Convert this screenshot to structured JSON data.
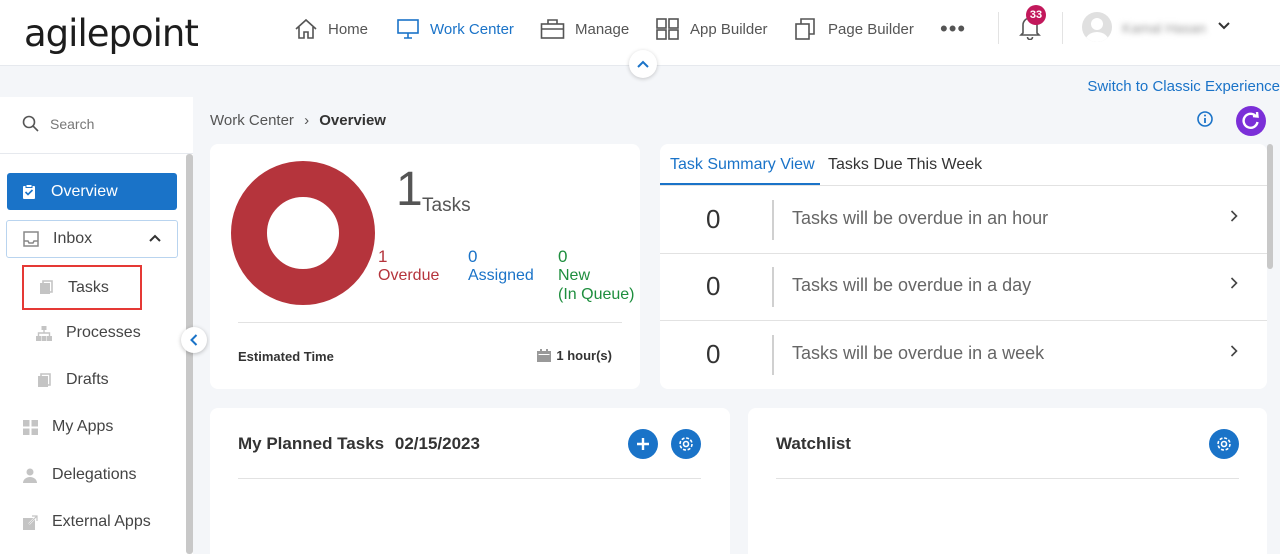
{
  "header": {
    "logo": "agilepoint",
    "nav": [
      {
        "label": "Home",
        "icon": "home-icon"
      },
      {
        "label": "Work Center",
        "icon": "monitor-icon",
        "active": true
      },
      {
        "label": "Manage",
        "icon": "briefcase-icon"
      },
      {
        "label": "App Builder",
        "icon": "grid-icon"
      },
      {
        "label": "Page Builder",
        "icon": "pages-icon"
      }
    ],
    "more": "•••",
    "notification_count": "33",
    "user_name": "Kamal Hasan"
  },
  "switch_link": "Switch to Classic Experience",
  "sidebar": {
    "search_placeholder": "Search",
    "items": {
      "overview": "Overview",
      "inbox": "Inbox",
      "tasks": "Tasks",
      "processes": "Processes",
      "drafts": "Drafts",
      "my_apps": "My Apps",
      "delegations": "Delegations",
      "external_apps": "External Apps"
    }
  },
  "breadcrumb": {
    "parent": "Work Center",
    "separator": "›",
    "current": "Overview"
  },
  "task_card": {
    "total": "1",
    "total_label": "Tasks",
    "overdue": {
      "value": "1",
      "label": "Overdue",
      "color": "#b5343c"
    },
    "assigned": {
      "value": "0",
      "label": "Assigned",
      "color": "#1a73c8"
    },
    "new": {
      "value": "0",
      "label": "New",
      "sublabel": "(In Queue)",
      "color": "#1e8e3e"
    },
    "estimated_label": "Estimated Time",
    "estimated_value": "1 hour(s)"
  },
  "summary": {
    "tabs": [
      "Task Summary View",
      "Tasks Due This Week"
    ],
    "rows": [
      {
        "count": "0",
        "text": "Tasks will be overdue in an hour"
      },
      {
        "count": "0",
        "text": "Tasks will be overdue in a day"
      },
      {
        "count": "0",
        "text": "Tasks will be overdue in a week"
      }
    ]
  },
  "planned": {
    "title": "My Planned Tasks",
    "date": "02/15/2023"
  },
  "watchlist": {
    "title": "Watchlist"
  },
  "colors": {
    "accent": "#1a73c8",
    "overdue": "#b5343c",
    "refresh": "#7b2fd8",
    "highlight": "#e53935"
  }
}
